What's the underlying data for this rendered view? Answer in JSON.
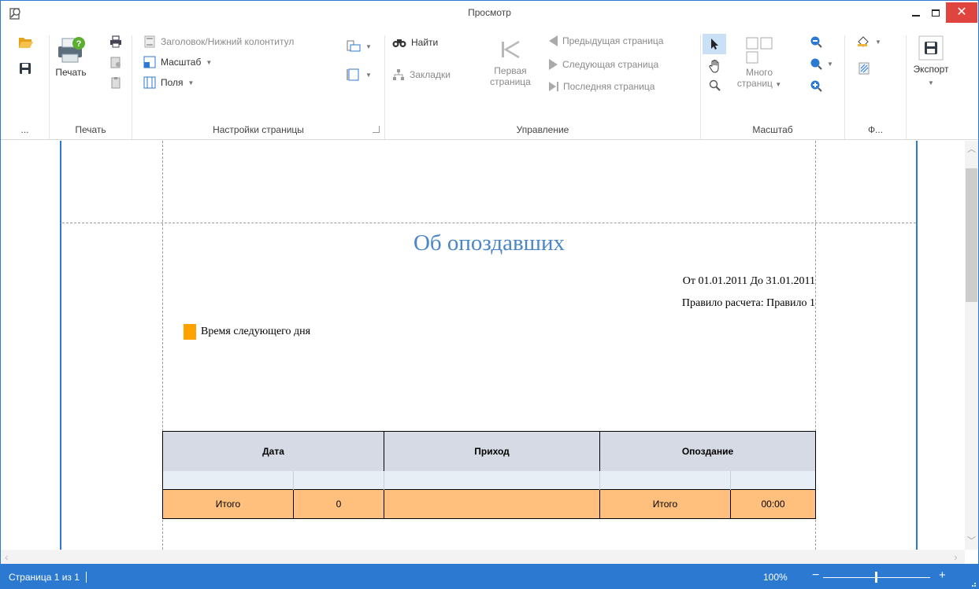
{
  "window": {
    "title": "Просмотр"
  },
  "ribbon": {
    "file_group": {
      "more_label": "..."
    },
    "print_group": {
      "label": "Печать",
      "print_label": "Печать"
    },
    "page_setup_group": {
      "label": "Настройки страницы",
      "header_footer": "Заголовок/Нижний колонтитул",
      "scale": "Масштаб",
      "margins": "Поля"
    },
    "navigation_group": {
      "label": "Управление",
      "find": "Найти",
      "bookmarks": "Закладки",
      "first_page_line1": "Первая",
      "first_page_line2": "страница",
      "previous_page": "Предыдущая страница",
      "next_page": "Следующая страница",
      "last_page": "Последняя страница"
    },
    "zoom_group": {
      "label": "Масштаб",
      "many_pages_line1": "Много",
      "many_pages_line2": "страниц"
    },
    "background_group": {
      "label": "Ф..."
    },
    "export_group": {
      "export": "Экспорт"
    }
  },
  "report": {
    "title": "Об опоздавших",
    "period": "От 01.01.2011 До 31.01.2011",
    "rule": "Правило расчета: Правило 1",
    "legend": "Время следующего дня",
    "legend_color": "#ffa200",
    "columns": [
      "Дата",
      "Приход",
      "Опоздание"
    ],
    "total_row": [
      "Итого",
      "0",
      "",
      "Итого",
      "00:00"
    ],
    "header_color": "#d5dae5",
    "total_color": "#ffc07d",
    "title_color": "#4a86c8"
  },
  "status": {
    "page_info": "Страница 1 из 1",
    "zoom": "100%",
    "zoom_minus": "−",
    "zoom_plus": "+",
    "zoom_level": 0.5
  },
  "colors": {
    "accent": "#2b79d0",
    "close": "#e0443e"
  }
}
